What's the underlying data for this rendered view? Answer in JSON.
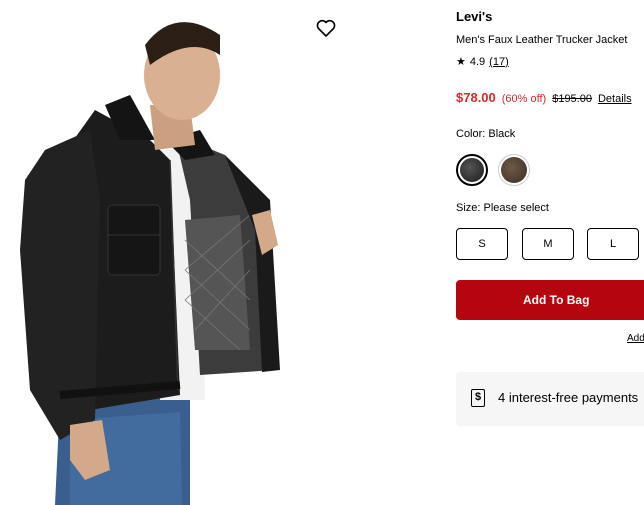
{
  "product": {
    "brand": "Levi's",
    "name": "Men's Faux Leather Trucker Jacket",
    "rating": "4.9",
    "review_count": "(17)",
    "sale_price": "$78.00",
    "discount": "(60% off)",
    "original_price": "$195.00",
    "details_link": "Details"
  },
  "color": {
    "label": "Color: Black",
    "swatches": [
      "Black",
      "Brown"
    ]
  },
  "size": {
    "label": "Size: Please select",
    "options": [
      "S",
      "M",
      "L"
    ]
  },
  "actions": {
    "add_to_bag": "Add To Bag",
    "add_link": "Add"
  },
  "payments": {
    "text": "4 interest-free payments"
  },
  "colors": {
    "sale_red": "#d12b2b",
    "button_red": "#b5050e"
  },
  "icons": {
    "wishlist": "heart-icon",
    "rating": "star-icon",
    "payments": "dollar-icon"
  }
}
